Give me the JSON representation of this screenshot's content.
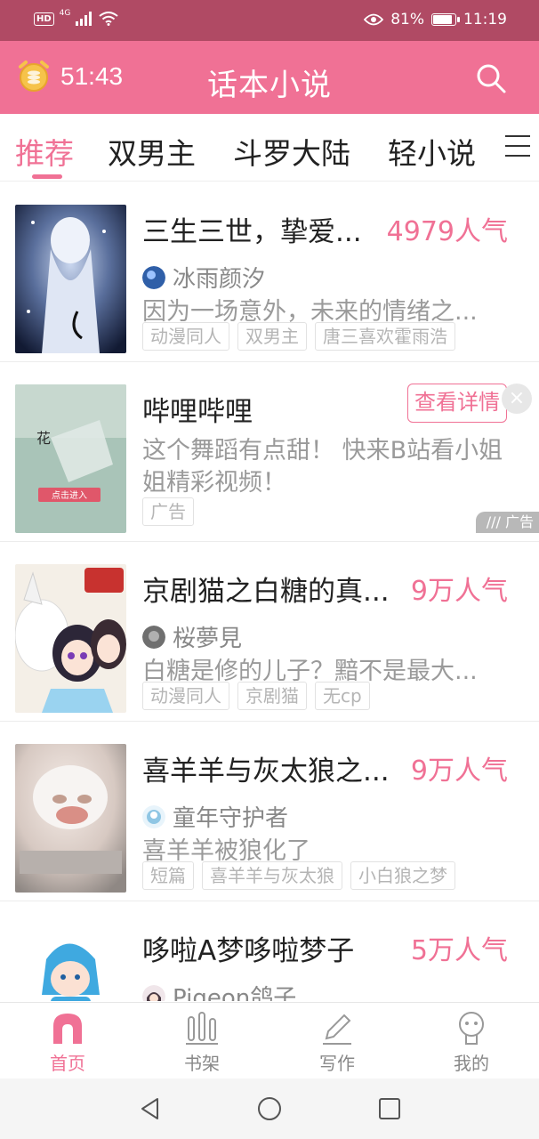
{
  "status_bar": {
    "hd": "HD",
    "network": "4G",
    "battery_pct": "81%",
    "battery_level": 0.81,
    "time": "11:19"
  },
  "header": {
    "timer": "51:43",
    "title": "话本小说",
    "timer_icon": "alarm-clock-icon",
    "search_icon": "search-icon"
  },
  "tabs": [
    {
      "label": "推荐",
      "active": true
    },
    {
      "label": "双男主",
      "active": false
    },
    {
      "label": "斗罗大陆",
      "active": false
    },
    {
      "label": "轻小说",
      "active": false
    }
  ],
  "feed": {
    "items": [
      {
        "title": "三生三世，挚爱...",
        "popularity": "4979人气",
        "author": "冰雨颜汐",
        "description": "因为一场意外，未来的情绪之...",
        "tags": [
          "动漫同人",
          "双男主",
          "唐三喜欢霍雨浩"
        ]
      },
      {
        "title": "京剧猫之白糖的真...",
        "popularity": "9万人气",
        "author": "桜夢見",
        "description": "白糖是修的儿子？黯不是最大...",
        "tags": [
          "动漫同人",
          "京剧猫",
          "无cp"
        ]
      },
      {
        "title": "喜羊羊与灰太狼之...",
        "popularity": "9万人气",
        "author": "童年守护者",
        "description": "喜羊羊被狼化了",
        "tags": [
          "短篇",
          "喜羊羊与灰太狼",
          "小白狼之梦"
        ]
      },
      {
        "title": "哆啦A梦哆啦梦子",
        "popularity": "5万人气",
        "author": "Pigeon鸽子",
        "description": "",
        "tags": []
      }
    ],
    "ad": {
      "title": "哔哩哔哩",
      "cta": "查看详情",
      "close": "×",
      "description": "这个舞蹈有点甜！ 快来B站看小姐姐精彩视频！",
      "badge": "广告",
      "mark": "广告",
      "cover_text_1": "点击进入",
      "cover_text_2": "花"
    }
  },
  "bottom_nav": [
    {
      "label": "首页",
      "icon": "home-icon",
      "active": true
    },
    {
      "label": "书架",
      "icon": "bookshelf-icon",
      "active": false
    },
    {
      "label": "写作",
      "icon": "pencil-icon",
      "active": false
    },
    {
      "label": "我的",
      "icon": "profile-icon",
      "active": false
    }
  ],
  "colors": {
    "brand": "#f07195",
    "status_bar": "#b04a64"
  }
}
